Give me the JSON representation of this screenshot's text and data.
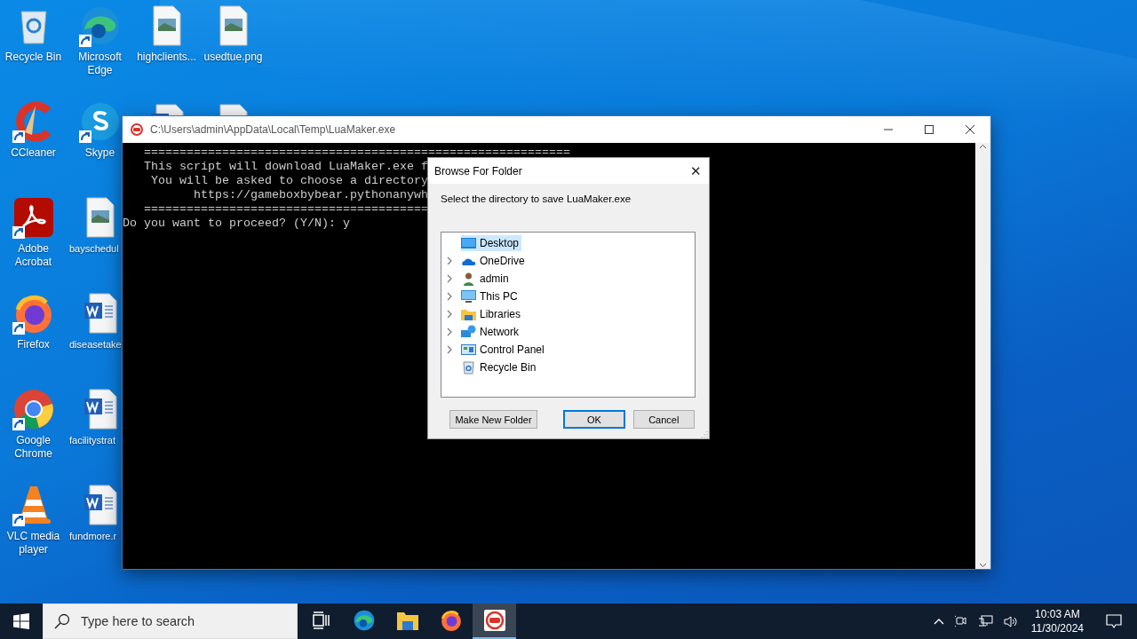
{
  "desktop_columns": [
    [
      {
        "label": "Recycle Bin",
        "kind": "recycle-bin",
        "shortcut": false
      },
      {
        "label": "CCleaner",
        "kind": "ccleaner",
        "shortcut": true
      },
      {
        "label": "Adobe Acrobat",
        "kind": "acrobat",
        "shortcut": true
      },
      {
        "label": "Firefox",
        "kind": "firefox",
        "shortcut": true
      },
      {
        "label": "Google Chrome",
        "kind": "chrome",
        "shortcut": true
      },
      {
        "label": "VLC media player",
        "kind": "vlc",
        "shortcut": true
      }
    ],
    [
      {
        "label": "Microsoft Edge",
        "kind": "edge",
        "shortcut": true
      },
      {
        "label": "Skype",
        "kind": "skype",
        "shortcut": true
      },
      {
        "label": "bayschedul",
        "kind": "image-file",
        "shortcut": false
      },
      {
        "label": "diseasetake",
        "kind": "word-file",
        "shortcut": false
      },
      {
        "label": "facilitystrat",
        "kind": "word-file",
        "shortcut": false
      },
      {
        "label": "fundmore.r",
        "kind": "word-file",
        "shortcut": false
      }
    ],
    [
      {
        "label": "highclients...",
        "kind": "image-file",
        "shortcut": false
      },
      {
        "kind": "word-file",
        "shortcut": false
      }
    ],
    [
      {
        "label": "usedtue.png",
        "kind": "image-file",
        "shortcut": false
      },
      {
        "kind": "image-file",
        "shortcut": false
      }
    ]
  ],
  "console_window": {
    "title": "C:\\Users\\admin\\AppData\\Local\\Temp\\LuaMaker.exe",
    "lines": [
      "   ============================================================",
      "   This script will download LuaMaker.exe f",
      "    You will be asked to choose a directory",
      "          https://gameboxbybear.pythonanywh",
      "   ========================================",
      "Do you want to proceed? (Y/N): y"
    ]
  },
  "dialog": {
    "title": "Browse For Folder",
    "close": "✕",
    "prompt": "Select the directory to save LuaMaker.exe",
    "tree": [
      {
        "label": "Desktop",
        "kind": "desktop",
        "selected": true,
        "has_children": false
      },
      {
        "label": "OneDrive",
        "kind": "cloud",
        "selected": false,
        "has_children": true
      },
      {
        "label": "admin",
        "kind": "user",
        "selected": false,
        "has_children": true
      },
      {
        "label": "This PC",
        "kind": "monitor",
        "selected": false,
        "has_children": true
      },
      {
        "label": "Libraries",
        "kind": "libraries",
        "selected": false,
        "has_children": true
      },
      {
        "label": "Network",
        "kind": "network",
        "selected": false,
        "has_children": true
      },
      {
        "label": "Control Panel",
        "kind": "control-panel",
        "selected": false,
        "has_children": true
      },
      {
        "label": "Recycle Bin",
        "kind": "recycle-bin",
        "selected": false,
        "has_children": false
      }
    ],
    "buttons": [
      {
        "label": "Make New Folder",
        "focused": false
      },
      {
        "label": "OK",
        "focused": true
      },
      {
        "label": "Cancel",
        "focused": false
      }
    ]
  },
  "taskbar": {
    "search": {
      "placeholder": "Type here to search"
    },
    "apps": [
      {
        "kind": "task-view",
        "active": false
      },
      {
        "kind": "edge",
        "active": false
      },
      {
        "kind": "explorer",
        "active": false
      },
      {
        "kind": "firefox",
        "active": false
      },
      {
        "kind": "console-app",
        "active": true
      }
    ],
    "tray": {
      "time": "10:03 AM",
      "date": "11/30/2024"
    }
  }
}
